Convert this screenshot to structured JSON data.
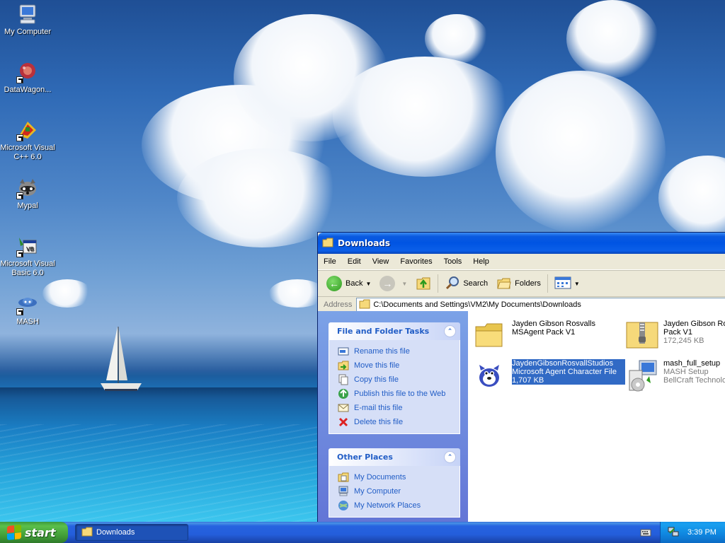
{
  "desktop": {
    "icons": [
      {
        "label": "My Computer",
        "icon": "my-computer-icon"
      },
      {
        "label": "DataWagon...",
        "icon": "datawagon-icon"
      },
      {
        "label": "Microsoft Visual C++ 6.0",
        "icon": "visual-cpp-icon"
      },
      {
        "label": "Mypal",
        "icon": "mypal-raccoon-icon"
      },
      {
        "label": "Microsoft Visual Basic 6.0",
        "icon": "visual-basic-icon"
      },
      {
        "label": "MASH",
        "icon": "mash-icon"
      }
    ]
  },
  "window": {
    "title": "Downloads",
    "menu": [
      "File",
      "Edit",
      "View",
      "Favorites",
      "Tools",
      "Help"
    ],
    "toolbar": {
      "back": "Back",
      "search": "Search",
      "folders": "Folders"
    },
    "address": {
      "label": "Address",
      "value": "C:\\Documents and Settings\\VM2\\My Documents\\Downloads"
    },
    "tasks": {
      "title": "File and Folder Tasks",
      "items": [
        {
          "label": "Rename this file",
          "icon": "rename-icon"
        },
        {
          "label": "Move this file",
          "icon": "move-icon"
        },
        {
          "label": "Copy this file",
          "icon": "copy-icon"
        },
        {
          "label": "Publish this file to the Web",
          "icon": "publish-web-icon"
        },
        {
          "label": "E-mail this file",
          "icon": "email-icon"
        },
        {
          "label": "Delete this file",
          "icon": "delete-icon"
        }
      ]
    },
    "other_places": {
      "title": "Other Places",
      "items": [
        {
          "label": "My Documents",
          "icon": "my-documents-icon"
        },
        {
          "label": "My Computer",
          "icon": "my-computer-icon"
        },
        {
          "label": "My Network Places",
          "icon": "network-places-icon"
        }
      ]
    },
    "files": [
      {
        "name": "Jayden Gibson Rosvalls MSAgent Pack V1",
        "line2": "",
        "line3": "",
        "icon": "folder-icon",
        "selected": false
      },
      {
        "name": "Jayden Gibson Ro",
        "line2": "Pack V1",
        "line3": "172,245 KB",
        "icon": "zip-folder-icon",
        "selected": false
      },
      {
        "name": "JaydenGibsonRosvallStudios",
        "line2": "Microsoft Agent Character File",
        "line3": "1,707 KB",
        "icon": "agent-character-icon",
        "selected": true
      },
      {
        "name": "mash_full_setup",
        "line2": "MASH Setup",
        "line3": "BellCraft Technolo",
        "icon": "setup-installer-icon",
        "selected": false
      }
    ]
  },
  "taskbar": {
    "start_label": "start",
    "task_label": "Downloads",
    "clock": "3:39 PM"
  },
  "colors": {
    "xp_blue": "#0054e3",
    "start_green": "#3f9a36",
    "task_link": "#215dc6",
    "selection": "#316ac5"
  }
}
